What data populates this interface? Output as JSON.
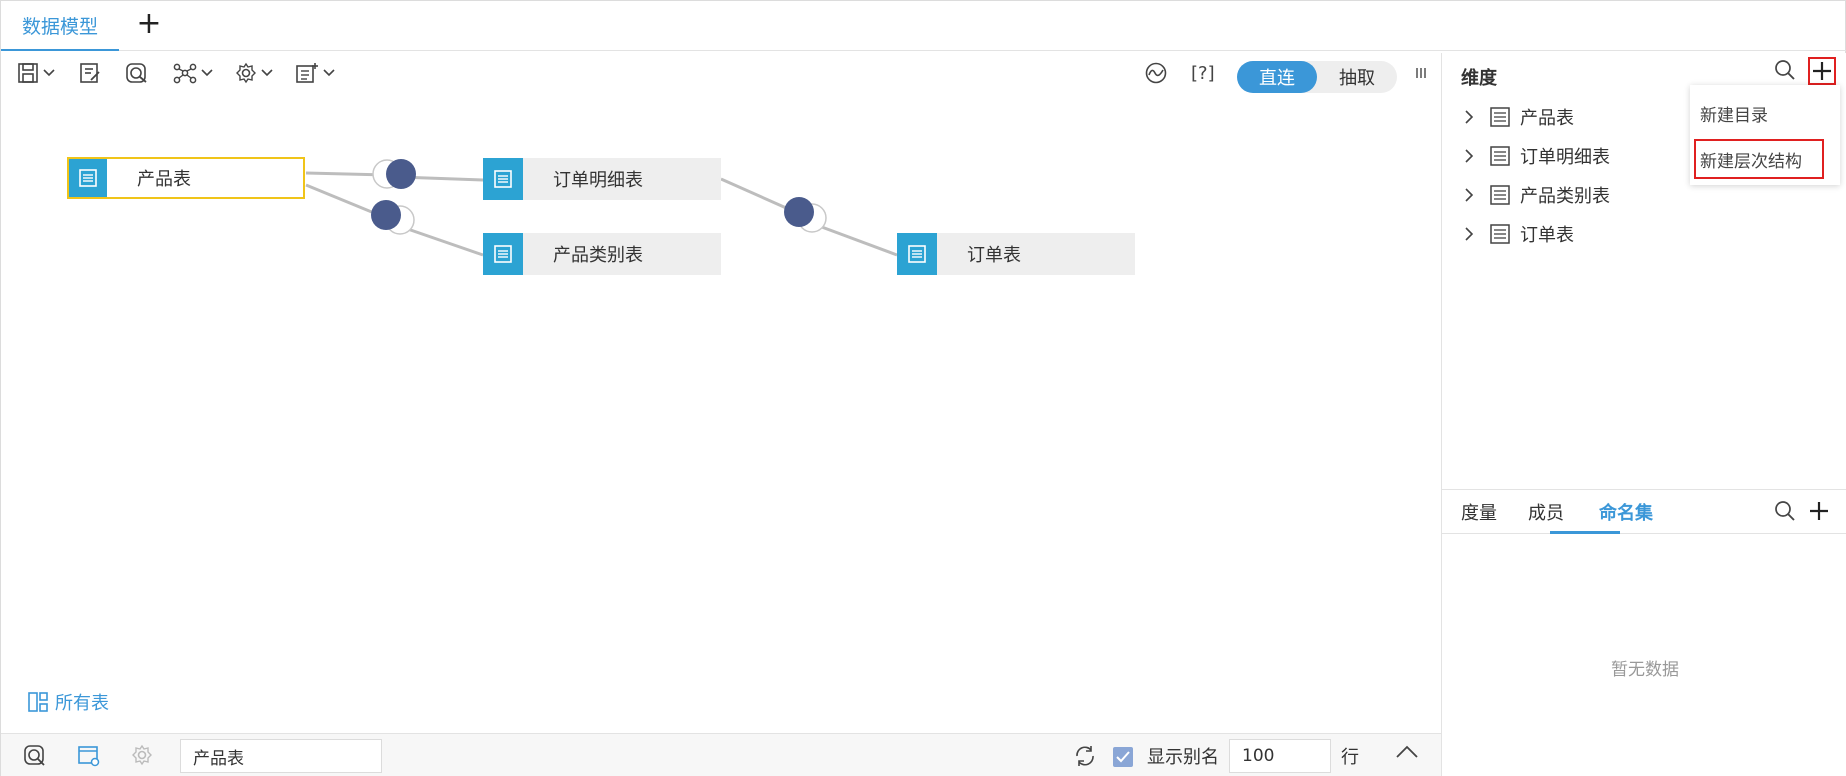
{
  "tabs": [
    {
      "label": "数据模型"
    }
  ],
  "toolbar": {
    "mode_options": [
      "直连",
      "抽取"
    ],
    "mode_selected": "直连",
    "help_label": "[?]"
  },
  "canvas": {
    "nodes": [
      {
        "label": "产品表",
        "selected": true
      },
      {
        "label": "订单明细表"
      },
      {
        "label": "产品类别表"
      },
      {
        "label": "订单表"
      }
    ],
    "all_tables_label": "所有表"
  },
  "bottombar": {
    "table_select_value": "产品表",
    "show_alias_checked": true,
    "show_alias_label": "显示别名",
    "rows_value": "100",
    "rows_unit": "行"
  },
  "dimension_panel": {
    "title": "维度",
    "tree": [
      {
        "label": "产品表"
      },
      {
        "label": "订单明细表"
      },
      {
        "label": "产品类别表"
      },
      {
        "label": "订单表"
      }
    ],
    "add_menu": [
      {
        "label": "新建目录"
      },
      {
        "label": "新建层次结构",
        "highlighted": true
      }
    ]
  },
  "lower_panel": {
    "tabs": [
      {
        "label": "度量"
      },
      {
        "label": "成员"
      },
      {
        "label": "命名集",
        "active": true
      }
    ],
    "empty_text": "暂无数据"
  },
  "colors": {
    "accent": "#3b97d8",
    "table_icon": "#2ca3d3",
    "join_node": "#4a5b8c",
    "selection_border": "#f0c419",
    "highlight_red": "#e02020"
  }
}
